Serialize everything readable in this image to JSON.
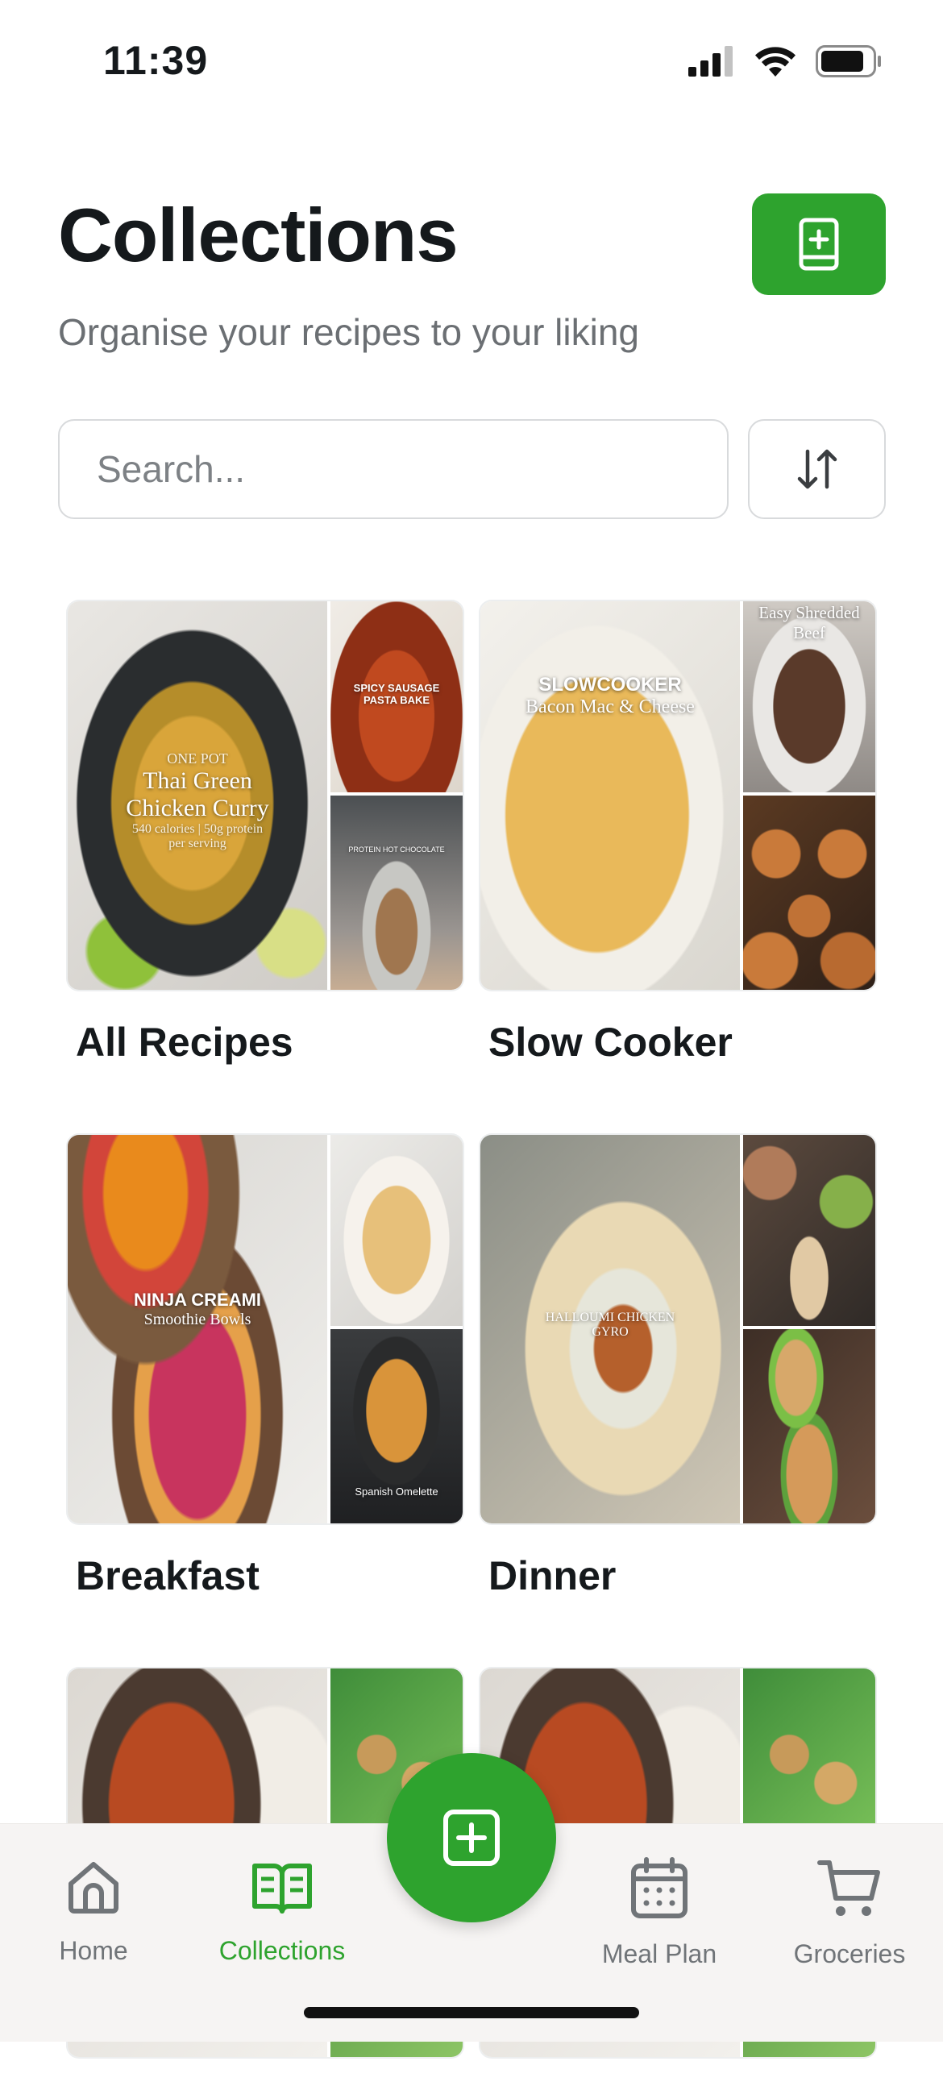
{
  "status": {
    "time": "11:39"
  },
  "header": {
    "title": "Collections",
    "subtitle": "Organise your recipes to your liking"
  },
  "search": {
    "placeholder": "Search..."
  },
  "collections": [
    {
      "label": "All Recipes",
      "images": {
        "main": {
          "line1": "ONE POT",
          "line2": "Thai Green",
          "line3": "Chicken Curry",
          "line4": "540 calories | 50g protein",
          "line5": "per serving"
        },
        "top": {
          "line1": "SPICY SAUSAGE",
          "line2": "PASTA BAKE"
        },
        "bottom": {
          "line1": "PROTEIN HOT CHOCOLATE"
        }
      }
    },
    {
      "label": "Slow Cooker",
      "images": {
        "main": {
          "line1": "SLOWCOOKER",
          "line2": "Bacon Mac & Cheese"
        },
        "top": {
          "line1": "Easy Shredded",
          "line2": "Beef"
        },
        "bottom": {
          "line1": ""
        }
      }
    },
    {
      "label": "Breakfast",
      "images": {
        "main": {
          "line1": "NINJA CREAMI",
          "line2": "Smoothie Bowls"
        },
        "top": {
          "line1": ""
        },
        "bottom": {
          "line1": "Spanish Omelette"
        }
      }
    },
    {
      "label": "Dinner",
      "images": {
        "main": {
          "line1": "HALLOUMI CHICKEN",
          "line2": "GYRO"
        },
        "top": {
          "line1": ""
        },
        "bottom": {
          "line1": ""
        }
      }
    },
    {
      "label": "",
      "images": {}
    },
    {
      "label": "",
      "images": {}
    }
  ],
  "tabs": [
    {
      "label": "Home",
      "icon": "home-icon",
      "active": false
    },
    {
      "label": "Collections",
      "icon": "book-icon",
      "active": true
    },
    {
      "label": "Meal Plan",
      "icon": "calendar-icon",
      "active": false
    },
    {
      "label": "Groceries",
      "icon": "cart-icon",
      "active": false
    }
  ],
  "colors": {
    "accent": "#2ea32e",
    "text": "#15191c",
    "muted": "#6b6f73"
  }
}
